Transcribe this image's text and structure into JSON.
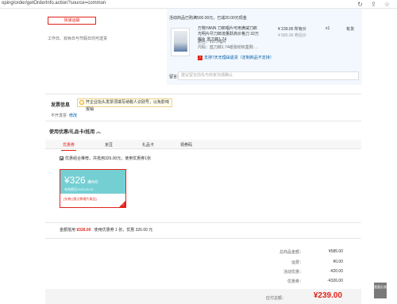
{
  "browser": {
    "url": "oping/order/getOrderInfo.action?source=common",
    "icons": [
      "refresh-icon",
      "share-icon",
      "star-icon"
    ]
  },
  "shipping": {
    "selected_label": "快递运输",
    "work_hint": "工作日、双休日与节假日均可送货"
  },
  "product": {
    "promo": "活动商品已购满500.00元，已减20.00元现金",
    "title": "万物YANN 刀郎唱片可用满减刀郎光明片尽刀郎流量跃高价格刀 32万唱片 蓝刀郎1.74",
    "price": "¥ 239.00 所有价",
    "orig_price": "¥ 585.00 券后价",
    "qty": "x1",
    "stock": "有货",
    "attr1": "颜色：1072唱片",
    "attr2": "尺码：蓝刀郎1.74纸张纺织盒刚 ...",
    "gift": "支持7天无理由退货（定制商品不支持）",
    "remark_label": "留言:",
    "remark_placeholder": "建议留言前先与商家沟通确认"
  },
  "invoice": {
    "title": "发票信息",
    "tip": "开企业抬头发票须填写纳税人识别号，以免影响报销",
    "value": "不开发票",
    "edit": "修改"
  },
  "coupons": {
    "title": "使用优惠/礼品卡/抵用",
    "tabs": [
      "优惠券",
      "京豆",
      "礼品卡",
      "领券码"
    ],
    "active_tab_badge": "",
    "option": "优惠组合推荐，共抵用326.00元，使用优惠券1张",
    "card": {
      "amount": "¥326",
      "cond": "满400",
      "expire": "有效期至2023-05-13",
      "desc": "[东券] [限刀郎唱片商品]"
    },
    "summary_prefix": "金额抵用",
    "summary_amount": "¥326.00",
    "summary_suffix": "使用优惠券 1 张，优惠 326.00 元"
  },
  "totals": {
    "rows": [
      {
        "k": "总商品金额：",
        "v": "¥585.00"
      },
      {
        "k": "运费：",
        "v": "¥0.00"
      },
      {
        "k": "活动优惠：",
        "v": "-¥20.00"
      },
      {
        "k": "优惠券：",
        "v": "-¥326.00"
      }
    ],
    "payable_label": "应付总额：",
    "payable_amount": "¥239.00"
  },
  "side": {
    "label": "我要反馈"
  },
  "colors": {
    "accent": "#e2231a",
    "coupon": "#74cfd3",
    "panel": "#f3f8fe"
  }
}
